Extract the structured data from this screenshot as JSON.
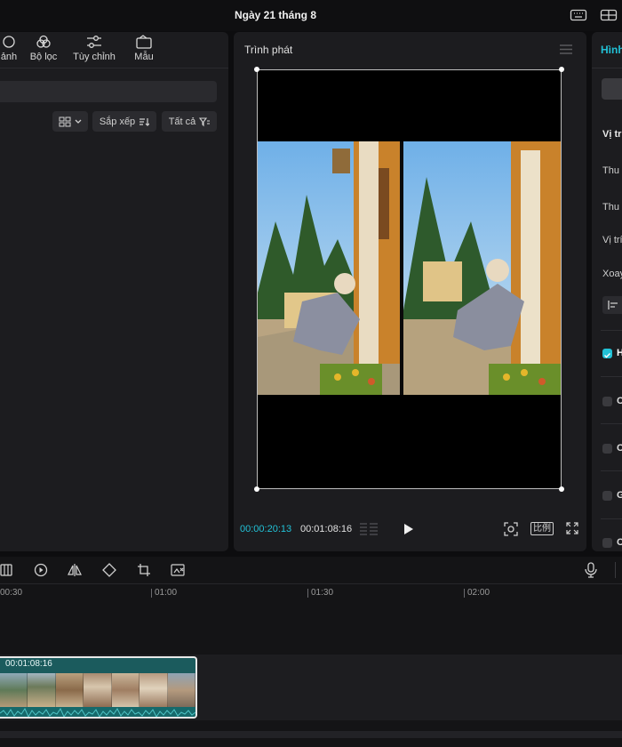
{
  "window": {
    "title": "Ngày 21 tháng 8"
  },
  "left_panel": {
    "toolbar": [
      {
        "label": "ảnh",
        "icon": "adjust-image-icon"
      },
      {
        "label": "Bộ lọc",
        "icon": "filter-circles-icon"
      },
      {
        "label": "Tùy chỉnh",
        "icon": "sliders-icon"
      },
      {
        "label": "Mẫu",
        "icon": "template-icon"
      }
    ],
    "sort_label": "Sắp xếp",
    "all_label": "Tất cả"
  },
  "player": {
    "title": "Trình phát",
    "time_current": "00:00:20:13",
    "time_total": "00:01:08:16",
    "ratio_label": "比例"
  },
  "right_panel": {
    "tab_label": "Hình",
    "position_header": "Vị trí",
    "labels": [
      "Thu",
      "Thu",
      "Vị trí",
      "Xoay"
    ],
    "checkboxes": [
      {
        "label": "H",
        "checked": true
      },
      {
        "label": "C",
        "checked": false
      },
      {
        "label": "C",
        "checked": false
      },
      {
        "label": "G",
        "checked": false
      },
      {
        "label": "C",
        "checked": false
      }
    ]
  },
  "timeline": {
    "ruler_labels": [
      "00:30",
      "01:00",
      "01:30",
      "02:00"
    ],
    "clip_duration": "00:01:08:16"
  },
  "colors": {
    "accent": "#22c1d6",
    "clip": "#1b5b5d",
    "panel": "#1c1c1f"
  }
}
